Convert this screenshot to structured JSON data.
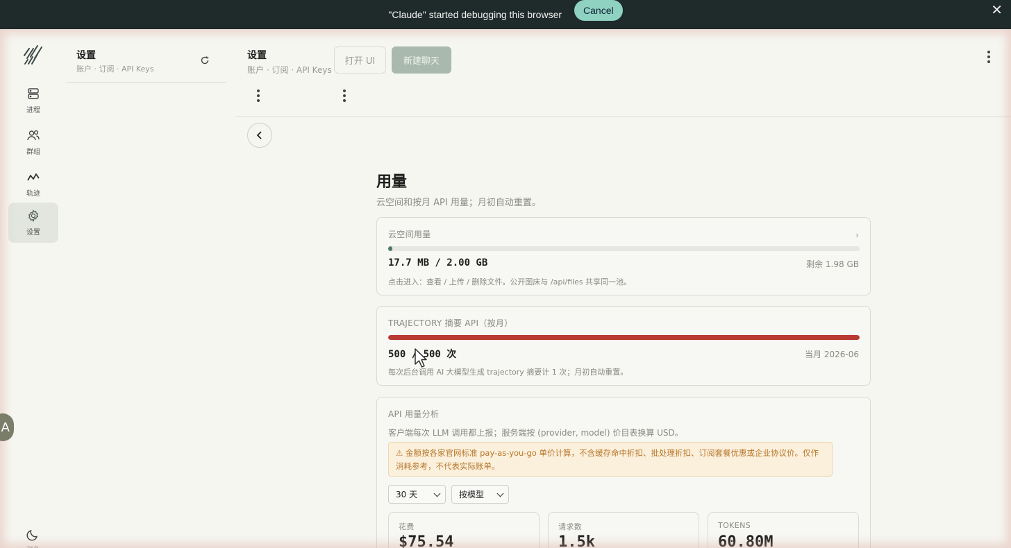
{
  "banner": {
    "text": "\"Claude\" started debugging this browser",
    "cancel_label": "Cancel",
    "close_glyph": "✕"
  },
  "rail": {
    "items": [
      {
        "label": "进程",
        "icon": "server-icon"
      },
      {
        "label": "群组",
        "icon": "users-icon"
      },
      {
        "label": "轨迹",
        "icon": "trajectory-icon"
      },
      {
        "label": "设置",
        "icon": "gear-icon",
        "active": true
      }
    ],
    "theme_label": "深色"
  },
  "translate_button": {
    "glyph": "A"
  },
  "sidebar": {
    "title": "设置",
    "subtitle": "账户 · 订阅 · API Keys"
  },
  "header": {
    "title": "设置",
    "subtitle": "账户 · 订阅 · API Keys",
    "open_ui_label": "打开 UI",
    "new_chat_label": "新建聊天"
  },
  "usage": {
    "title": "用量",
    "description": "云空间和按月 API 用量；月初自动重置。",
    "storage": {
      "label": "云空间用量",
      "chevron": "›",
      "value": "17.7 MB / 2.00 GB",
      "remaining": "剩余 1.98 GB",
      "fraction": 0.0086,
      "note": "点击进入：查看 / 上传 / 删除文件。公开图床与 /api/files 共享同一池。"
    },
    "trajectory": {
      "label": "TRAJECTORY 摘要 API（按月）",
      "value": "500 / 500 次",
      "period": "当月 2026-06",
      "fraction": 1.0,
      "note": "每次后台调用 AI 大模型生成 trajectory 摘要计 1 次；月初自动重置。"
    },
    "analysis": {
      "label": "API 用量分析",
      "description": "客户端每次 LLM 调用都上报；服务端按 (provider, model) 价目表换算 USD。",
      "warning": "⚠ 金额按各家官网标准 pay-as-you-go 单价计算，不含缓存命中折扣、批处理折扣、订阅套餐优惠或企业协议价。仅作消耗参考，不代表实际账单。",
      "range_select": "30 天",
      "group_select": "按模型",
      "stats": [
        {
          "label": "花费",
          "value": "$75.54"
        },
        {
          "label": "请求数",
          "value": "1.5k"
        },
        {
          "label": "TOKENS",
          "value": "60.80M"
        }
      ]
    }
  },
  "colors": {
    "storage_fill": "#4f7a68",
    "trajectory_fill": "#b83a32",
    "accent": "#a9b9ae"
  }
}
